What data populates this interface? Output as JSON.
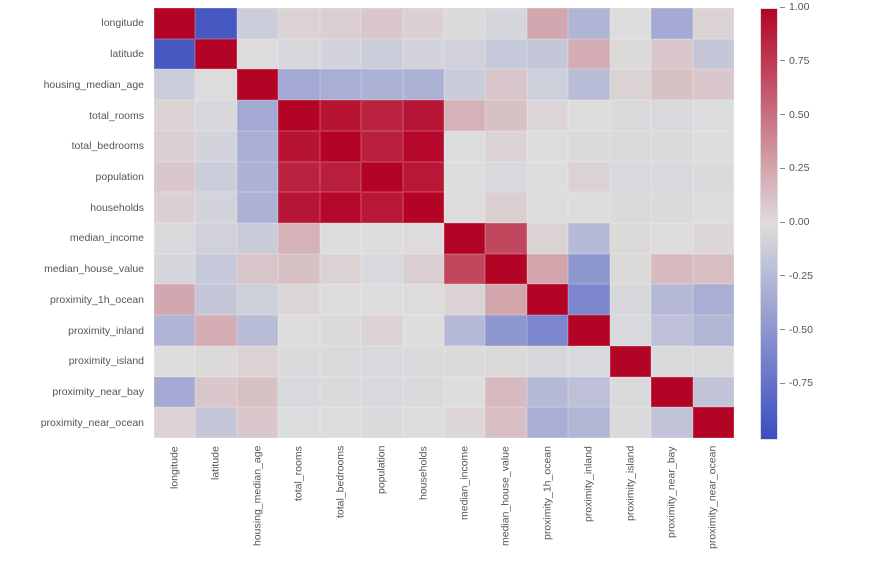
{
  "chart_data": {
    "type": "heatmap",
    "title": "",
    "xlabel": "",
    "ylabel": "",
    "colorscale": "coolwarm",
    "vmin": -1.0,
    "vmax": 1.0,
    "categories": [
      "longitude",
      "latitude",
      "housing_median_age",
      "total_rooms",
      "total_bedrooms",
      "population",
      "households",
      "median_income",
      "median_house_value",
      "proximity_1h_ocean",
      "proximity_inland",
      "proximity_island",
      "proximity_near_bay",
      "proximity_near_ocean"
    ],
    "matrix": [
      [
        1.0,
        -0.92,
        -0.11,
        0.05,
        0.07,
        0.1,
        0.06,
        -0.02,
        -0.05,
        0.25,
        -0.28,
        0.0,
        -0.35,
        0.05
      ],
      [
        -0.92,
        1.0,
        0.01,
        -0.04,
        -0.07,
        -0.11,
        -0.07,
        -0.08,
        -0.14,
        -0.15,
        0.22,
        0.02,
        0.1,
        -0.15
      ],
      [
        -0.11,
        0.01,
        1.0,
        -0.36,
        -0.32,
        -0.3,
        -0.3,
        -0.12,
        0.11,
        -0.1,
        -0.23,
        0.05,
        0.13,
        0.1
      ],
      [
        0.05,
        -0.04,
        -0.36,
        1.0,
        0.93,
        0.86,
        0.92,
        0.2,
        0.13,
        0.03,
        0.0,
        -0.02,
        -0.03,
        -0.01
      ],
      [
        0.07,
        -0.07,
        -0.32,
        0.93,
        1.0,
        0.88,
        0.98,
        -0.01,
        0.05,
        0.0,
        0.02,
        -0.02,
        -0.02,
        0.0
      ],
      [
        0.1,
        -0.11,
        -0.3,
        0.86,
        0.88,
        1.0,
        0.91,
        0.0,
        -0.03,
        0.0,
        0.05,
        -0.03,
        -0.03,
        -0.02
      ],
      [
        0.06,
        -0.07,
        -0.3,
        0.92,
        0.98,
        0.91,
        1.0,
        0.01,
        0.07,
        0.01,
        0.0,
        -0.02,
        -0.02,
        0.0
      ],
      [
        -0.02,
        -0.08,
        -0.12,
        0.2,
        -0.01,
        0.0,
        0.01,
        1.0,
        0.69,
        0.05,
        -0.24,
        0.02,
        0.0,
        0.03
      ],
      [
        -0.05,
        -0.14,
        0.11,
        0.13,
        0.05,
        -0.03,
        0.07,
        0.69,
        1.0,
        0.26,
        -0.48,
        0.02,
        0.16,
        0.14
      ],
      [
        0.25,
        -0.15,
        -0.1,
        0.03,
        0.0,
        0.0,
        0.01,
        0.05,
        0.26,
        1.0,
        -0.6,
        -0.04,
        -0.25,
        -0.32
      ],
      [
        -0.28,
        0.22,
        -0.23,
        0.0,
        0.02,
        0.05,
        0.0,
        -0.24,
        -0.48,
        -0.6,
        1.0,
        -0.03,
        -0.2,
        -0.27
      ],
      [
        0.0,
        0.02,
        0.05,
        -0.02,
        -0.02,
        -0.03,
        -0.02,
        0.02,
        0.02,
        -0.04,
        -0.03,
        1.0,
        -0.02,
        -0.02
      ],
      [
        -0.35,
        0.1,
        0.13,
        -0.03,
        -0.02,
        -0.03,
        -0.02,
        0.0,
        0.16,
        -0.25,
        -0.2,
        -0.02,
        1.0,
        -0.17
      ],
      [
        0.05,
        -0.15,
        0.1,
        -0.01,
        0.0,
        -0.02,
        0.0,
        0.03,
        0.14,
        -0.32,
        -0.27,
        -0.02,
        -0.17,
        1.0
      ]
    ],
    "colorbar_ticks": [
      -0.75,
      -0.5,
      -0.25,
      0.0,
      0.25,
      0.5,
      0.75,
      1.0
    ]
  }
}
